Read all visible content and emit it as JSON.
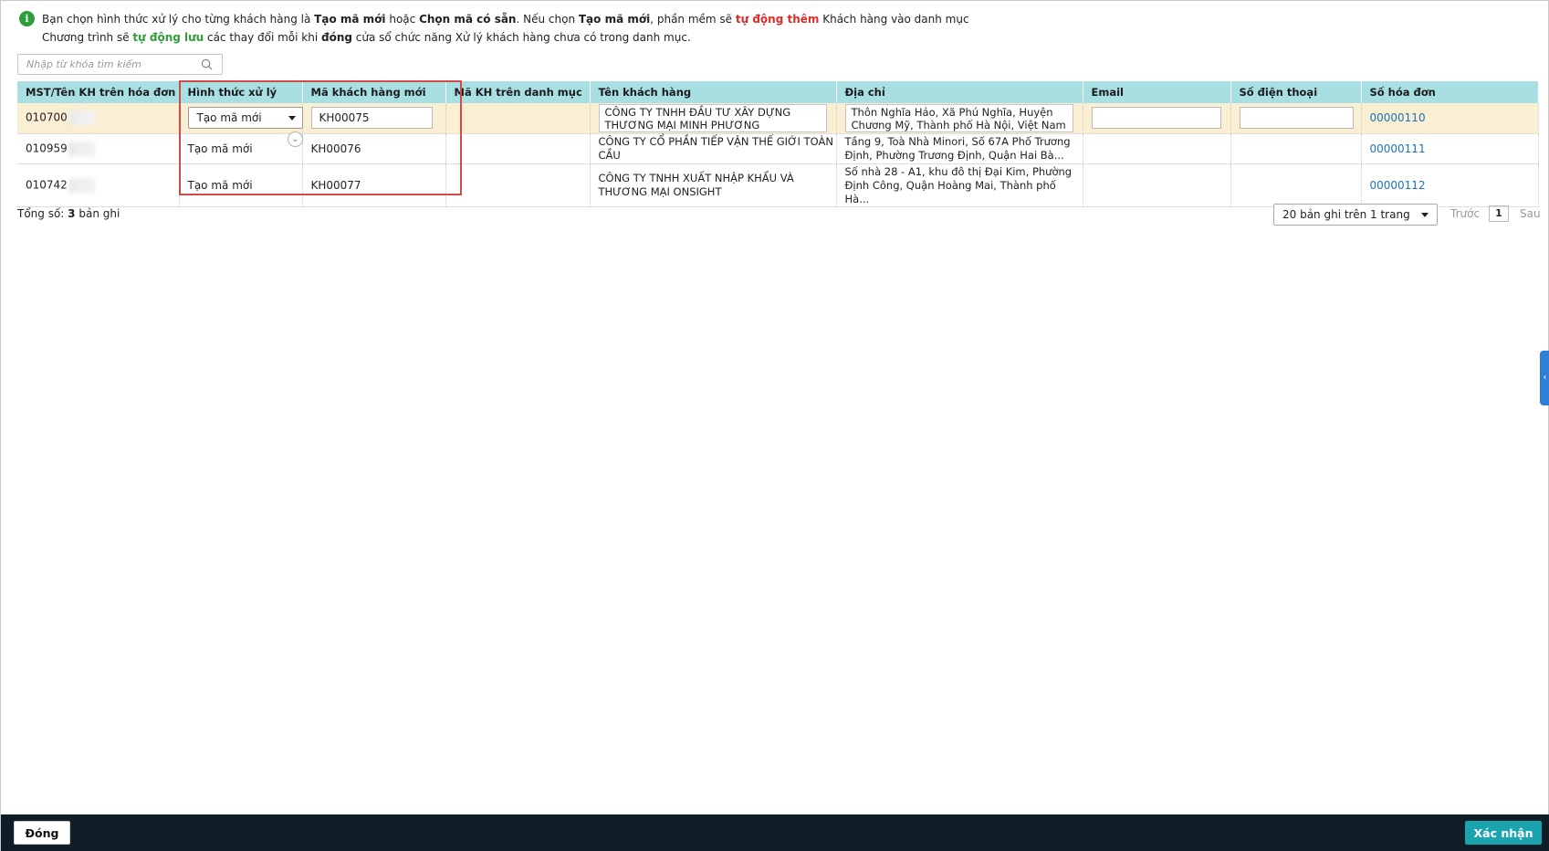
{
  "notice": {
    "line1": [
      {
        "t": "Bạn chọn hình thức xử lý cho từng khách hàng là ",
        "s": ""
      },
      {
        "t": "Tạo mã mới",
        "s": "b"
      },
      {
        "t": " hoặc ",
        "s": ""
      },
      {
        "t": "Chọn mã có sẵn",
        "s": "b"
      },
      {
        "t": ". Nếu chọn ",
        "s": ""
      },
      {
        "t": "Tạo mã mới",
        "s": "b"
      },
      {
        "t": ", phần mềm sẽ ",
        "s": ""
      },
      {
        "t": "tự động thêm",
        "s": "red"
      },
      {
        "t": " Khách hàng vào danh mục",
        "s": ""
      }
    ],
    "line2": [
      {
        "t": "Chương trình sẽ ",
        "s": ""
      },
      {
        "t": "tự động lưu",
        "s": "green"
      },
      {
        "t": " các thay đổi mỗi khi ",
        "s": ""
      },
      {
        "t": "đóng",
        "s": "b"
      },
      {
        "t": " cửa sổ chức năng Xử lý khách hàng chưa có trong danh mục.",
        "s": ""
      }
    ]
  },
  "search": {
    "placeholder": "Nhập từ khóa tìm kiếm"
  },
  "table": {
    "headers": {
      "mst": "MST/Tên KH trên hóa đơn",
      "method": "Hình thức xử lý",
      "new_code": "Mã khách hàng mới",
      "list_code": "Mã KH trên danh mục",
      "name": "Tên khách hàng",
      "address": "Địa chỉ",
      "email": "Email",
      "phone": "Số điện thoại",
      "invoice": "Số hóa đơn"
    },
    "rows": [
      {
        "mst": "010700",
        "method": "Tạo mã mới",
        "new_code": "KH00075",
        "list_code": "",
        "name": "CÔNG TY TNHH ĐẦU TƯ XÂY DỰNG THƯƠNG MẠI MINH PHƯƠNG",
        "address": "Thôn Nghĩa Hảo, Xã Phú Nghĩa, Huyện Chương Mỹ, Thành phố Hà Nội, Việt Nam",
        "email": "",
        "phone": "",
        "invoice": "00000110"
      },
      {
        "mst": "010959",
        "method": "Tạo mã mới",
        "new_code": "KH00076",
        "list_code": "",
        "name": "CÔNG TY CỔ PHẦN TIẾP VẬN THẾ GIỚI TOÀN CẦU",
        "address": "Tầng 9, Toà Nhà Minori, Số 67A Phố Trương Định, Phường Trương Định, Quận Hai Bà...",
        "email": "",
        "phone": "",
        "invoice": "00000111"
      },
      {
        "mst": "010742",
        "method": "Tạo mã mới",
        "new_code": "KH00077",
        "list_code": "",
        "name": "CÔNG TY TNHH XUẤT NHẬP KHẨU VÀ THƯƠNG MẠI ONSIGHT",
        "address": "Số nhà 28 - A1, khu đô thị Đại Kim, Phường Định Công, Quận Hoàng Mai, Thành phố Hà...",
        "email": "",
        "phone": "",
        "invoice": "00000112"
      }
    ]
  },
  "summary": {
    "label": "Tổng số: ",
    "count": "3",
    "suffix": " bản ghi"
  },
  "pager": {
    "page_size": "20 bản ghi trên 1 trang",
    "prev": "Trước",
    "page": "1",
    "next": "Sau"
  },
  "footer": {
    "close": "Đóng",
    "confirm": "Xác nhận"
  },
  "colors": {
    "header_bg": "#a8dfe3",
    "active_row": "#faefd3",
    "highlight": "#d14a4a",
    "footer_bg": "#0f1e26",
    "confirm": "#1ba3b0"
  }
}
